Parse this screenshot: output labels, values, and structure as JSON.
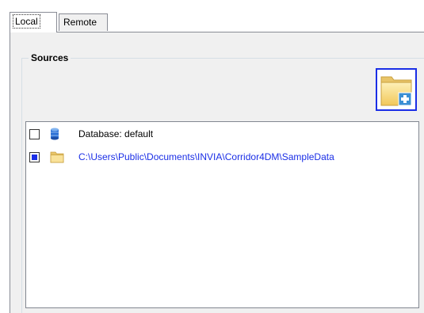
{
  "tabs": [
    {
      "label": "Local",
      "active": true
    },
    {
      "label": "Remote",
      "active": false
    }
  ],
  "sources_group": {
    "title": "Sources",
    "add_folder_icon": "folder-add-icon",
    "items": [
      {
        "checked": false,
        "icon": "database-icon",
        "label": "Database: default"
      },
      {
        "checked": true,
        "icon": "folder-icon",
        "label": "C:\\Users\\Public\\Documents\\INVIA\\Corridor4DM\\SampleData"
      }
    ]
  },
  "colors": {
    "selection": "#1a2ee6",
    "panel": "#f0f0f0"
  }
}
